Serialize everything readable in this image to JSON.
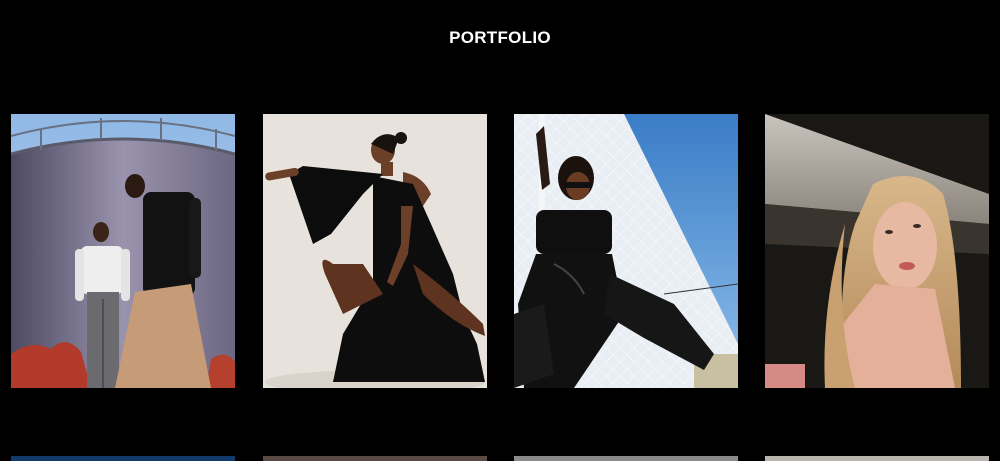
{
  "header": {
    "title": "PORTFOLIO"
  },
  "portfolio": {
    "row1": [
      {
        "name": "photo-two-men-silo",
        "icon": "photo-image"
      },
      {
        "name": "photo-woman-black-gown",
        "icon": "photo-image"
      },
      {
        "name": "photo-woman-fence-leather",
        "icon": "photo-image"
      },
      {
        "name": "photo-blonde-woman-portrait",
        "icon": "photo-image"
      }
    ],
    "row2_count_visible": 4
  },
  "colors": {
    "background": "#000000",
    "title": "#ffffff"
  }
}
